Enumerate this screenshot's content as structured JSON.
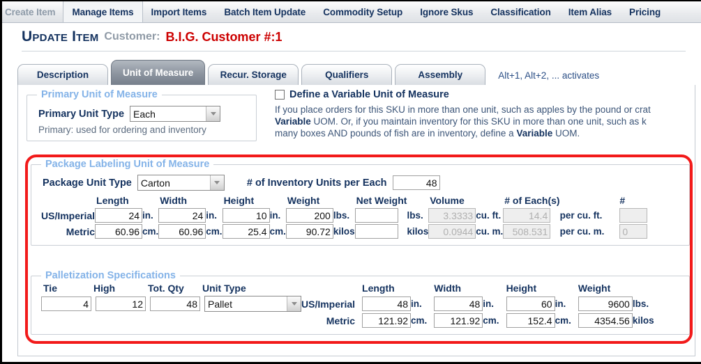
{
  "topnav": {
    "items": [
      {
        "label": "Create Item",
        "state": "disabled"
      },
      {
        "label": "Manage Items",
        "state": "active"
      },
      {
        "label": "Import Items",
        "state": "normal"
      },
      {
        "label": "Batch Item Update",
        "state": "normal"
      },
      {
        "label": "Commodity Setup",
        "state": "normal"
      },
      {
        "label": "Ignore Skus",
        "state": "normal"
      },
      {
        "label": "Classification",
        "state": "normal"
      },
      {
        "label": "Item Alias",
        "state": "normal"
      },
      {
        "label": "Pricing",
        "state": "normal"
      }
    ]
  },
  "header": {
    "title": "Update Item",
    "customer_label": "Customer:",
    "customer_value": "B.I.G. Customer #:1"
  },
  "tabs": {
    "items": [
      {
        "label": "Description",
        "active": false
      },
      {
        "label": "Unit of Measure",
        "active": true
      },
      {
        "label": "Recur. Storage",
        "active": false
      },
      {
        "label": "Qualifiers",
        "active": false
      },
      {
        "label": "Assembly",
        "active": false
      }
    ],
    "hint": "Alt+1, Alt+2, ... activates"
  },
  "primary_uom": {
    "legend": "Primary Unit of Measure",
    "unit_type_label": "Primary Unit Type",
    "unit_type_value": "Each",
    "note": "Primary: used for ordering and inventory"
  },
  "variable_uom": {
    "checkbox_label": "Define a Variable Unit of Measure",
    "checked": false,
    "description_line1_a": "If you place orders for this SKU in more than one unit, such as apples by the pound or crat",
    "description_line2_a": "Variable",
    "description_line2_b": " UOM. Or, if you maintain inventory for this SKU in more than one unit, such as k",
    "description_line3_a": "many boxes AND pounds of fish are in inventory, define a ",
    "description_line3_b": "Variable",
    "description_line3_c": " UOM."
  },
  "package_uom": {
    "legend": "Package Labeling Unit of Measure",
    "unit_type_label": "Package Unit Type",
    "unit_type_value": "Carton",
    "inventory_units_label": "# of Inventory Units per Each",
    "inventory_units_value": "48",
    "columns": {
      "length": "Length",
      "width": "Width",
      "height": "Height",
      "weight": "Weight",
      "net_weight": "Net Weight",
      "volume": "Volume",
      "each_count": "# of Each(s)",
      "cut_off": "#"
    },
    "rows": [
      {
        "label": "US/Imperial",
        "length": "24",
        "length_unit": "in.",
        "width": "24",
        "width_unit": "in.",
        "height": "10",
        "height_unit": "in.",
        "weight": "200",
        "weight_unit": "lbs.",
        "net_weight": "",
        "net_weight_unit": "lbs.",
        "volume": "3.3333",
        "volume_unit": "cu. ft.",
        "volume_readonly": true,
        "each_count": "14.4",
        "each_count_unit": "per cu. ft.",
        "each_count_readonly": true,
        "cut_off": ""
      },
      {
        "label": "Metric",
        "length": "60.96",
        "length_unit": "cm.",
        "width": "60.96",
        "width_unit": "cm.",
        "height": "25.4",
        "height_unit": "cm.",
        "weight": "90.72",
        "weight_unit": "kilos",
        "net_weight": "",
        "net_weight_unit": "kilos",
        "volume": "0.0944",
        "volume_unit": "cu. m.",
        "volume_readonly": true,
        "each_count": "508.531",
        "each_count_unit": "per cu. m.",
        "each_count_readonly": true,
        "cut_off": "0"
      }
    ]
  },
  "palletization": {
    "legend": "Palletization Specifications",
    "columns": {
      "tie": "Tie",
      "high": "High",
      "tot_qty": "Tot. Qty",
      "unit_type": "Unit Type",
      "length": "Length",
      "width": "Width",
      "height": "Height",
      "weight": "Weight"
    },
    "tie": "4",
    "high": "12",
    "tot_qty": "48",
    "unit_type_value": "Pallet",
    "rows": [
      {
        "label": "US/Imperial",
        "length": "48",
        "length_unit": "in.",
        "width": "48",
        "width_unit": "in.",
        "height": "60",
        "height_unit": "in.",
        "weight": "9600",
        "weight_unit": "lbs."
      },
      {
        "label": "Metric",
        "length": "121.92",
        "length_unit": "cm.",
        "width": "121.92",
        "width_unit": "cm.",
        "height": "152.4",
        "height_unit": "cm.",
        "weight": "4354.56",
        "weight_unit": "kilos"
      }
    ]
  },
  "colors": {
    "accent_blue": "#13315e",
    "legend_blue": "#84b3e8",
    "customer_red": "#cc0000",
    "highlight_red": "#f21a1a"
  }
}
